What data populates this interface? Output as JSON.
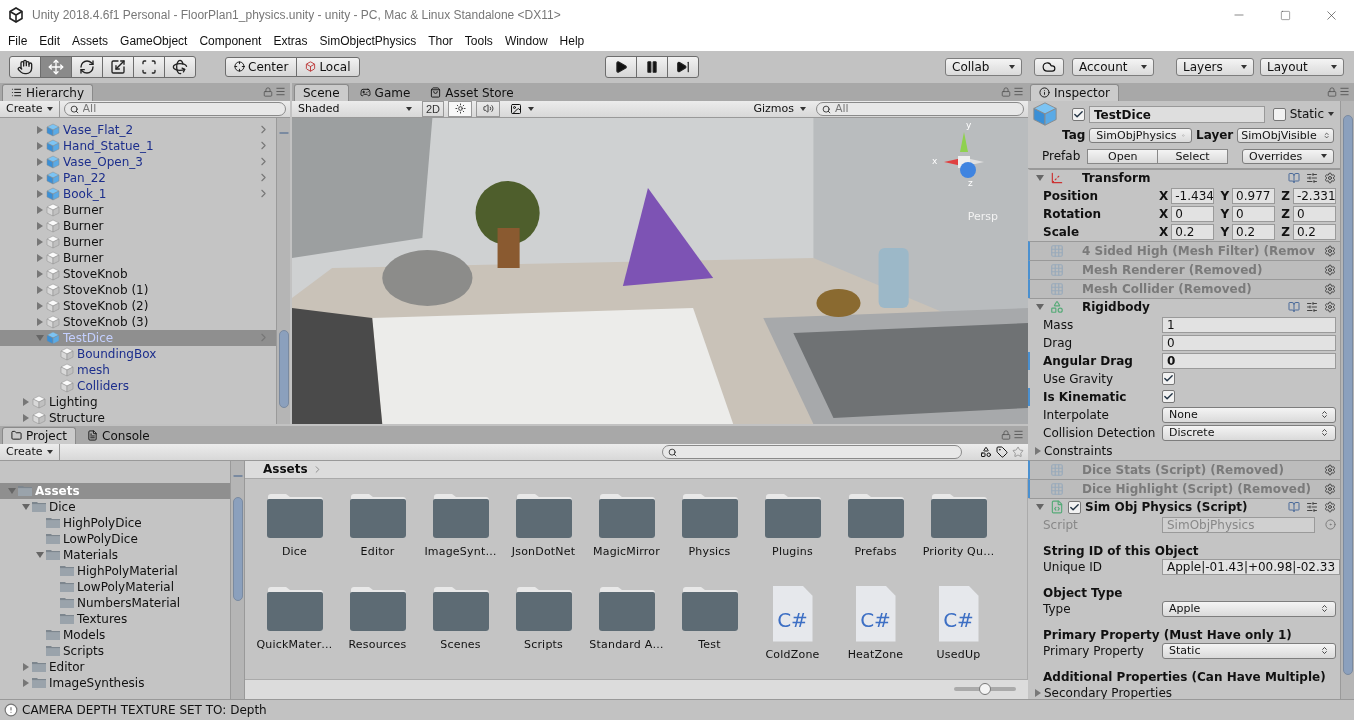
{
  "window": {
    "title": "Unity 2018.4.6f1 Personal - FloorPlan1_physics.unity - unity - PC, Mac & Linux Standalone <DX11>"
  },
  "menu": [
    "File",
    "Edit",
    "Assets",
    "GameObject",
    "Component",
    "Extras",
    "SimObjectPhysics",
    "Thor",
    "Tools",
    "Window",
    "Help"
  ],
  "toolbar": {
    "tools": [
      {
        "kind": "hand",
        "selected": false
      },
      {
        "kind": "move",
        "selected": true
      },
      {
        "kind": "rotate",
        "selected": false
      },
      {
        "kind": "scale",
        "selected": false
      },
      {
        "kind": "rect",
        "selected": false
      },
      {
        "kind": "transform",
        "selected": false
      }
    ],
    "pivot": [
      {
        "kind": "center",
        "label": "Center"
      },
      {
        "kind": "local",
        "label": "Local"
      }
    ],
    "play": [
      {
        "kind": "play"
      },
      {
        "kind": "pause"
      },
      {
        "kind": "step"
      }
    ],
    "collab": "Collab",
    "account": "Account",
    "layers": "Layers",
    "layout": "Layout"
  },
  "hierarchy": {
    "tab": {
      "label": "Hierarchy",
      "selected": true
    },
    "create": "Create",
    "search": {
      "placeholder": "All"
    },
    "scrolled_children": [
      {
        "name": "Vase_Flat_2",
        "kind": "prefab",
        "selected": false,
        "expanded": false
      },
      {
        "name": "Hand_Statue_1",
        "kind": "prefab",
        "selected": false,
        "expanded": false
      },
      {
        "name": "Vase_Open_3",
        "kind": "prefab",
        "selected": false,
        "expanded": false
      },
      {
        "name": "Pan_22",
        "kind": "prefab",
        "selected": false,
        "expanded": false
      },
      {
        "name": "Book_1",
        "kind": "prefab",
        "selected": false,
        "expanded": false
      },
      {
        "name": "Burner",
        "kind": "object",
        "selected": false,
        "expanded": false
      },
      {
        "name": "Burner",
        "kind": "object",
        "selected": false,
        "expanded": false
      },
      {
        "name": "Burner",
        "kind": "object",
        "selected": false,
        "expanded": false
      },
      {
        "name": "Burner",
        "kind": "object",
        "selected": false,
        "expanded": false
      },
      {
        "name": "StoveKnob",
        "kind": "object",
        "selected": false,
        "expanded": false
      },
      {
        "name": "StoveKnob (1)",
        "kind": "object",
        "selected": false,
        "expanded": false
      },
      {
        "name": "StoveKnob (2)",
        "kind": "object",
        "selected": false,
        "expanded": false
      },
      {
        "name": "StoveKnob (3)",
        "kind": "object",
        "selected": false,
        "expanded": false
      },
      {
        "name": "TestDice",
        "kind": "prefab",
        "selected": true,
        "expanded": true,
        "children": [
          {
            "name": "BoundingBox",
            "kind": "prefab_part",
            "selected": false
          },
          {
            "name": "mesh",
            "kind": "prefab_part",
            "selected": false
          },
          {
            "name": "Colliders",
            "kind": "prefab_part",
            "selected": false
          }
        ]
      }
    ],
    "items": [
      {
        "name": "Lighting",
        "kind": "object",
        "selected": false,
        "expanded": false
      },
      {
        "name": "Structure",
        "kind": "object",
        "selected": false,
        "expanded": false
      }
    ]
  },
  "scene": {
    "tabs": [
      {
        "label": "Scene",
        "kind": "scene",
        "selected": true
      },
      {
        "label": "Game",
        "kind": "game",
        "selected": false
      },
      {
        "label": "Asset Store",
        "kind": "store",
        "selected": false
      }
    ],
    "shading": "Shaded",
    "mode_2d": "2D",
    "toggles": [
      {
        "kind": "lighting",
        "on": true
      },
      {
        "kind": "audio",
        "on": false
      }
    ],
    "gizmos": "Gizmos",
    "search": {
      "placeholder": "All"
    },
    "gizmo_axes": [
      "y",
      "x",
      "z"
    ],
    "camera": "Persp"
  },
  "project": {
    "tabs": [
      {
        "label": "Project",
        "kind": "project",
        "selected": true
      },
      {
        "label": "Console",
        "kind": "console",
        "selected": false
      }
    ],
    "create": "Create",
    "tree": [
      {
        "name": "Assets",
        "selected": true,
        "expanded": true,
        "children": [
          {
            "name": "Dice",
            "selected": false,
            "expanded": true,
            "children": [
              {
                "name": "HighPolyDice",
                "selected": false
              },
              {
                "name": "LowPolyDice",
                "selected": false
              },
              {
                "name": "Materials",
                "selected": false,
                "expanded": true,
                "children": [
                  {
                    "name": "HighPolyMaterial",
                    "selected": false
                  },
                  {
                    "name": "LowPolyMaterial",
                    "selected": false
                  },
                  {
                    "name": "NumbersMaterial",
                    "selected": false
                  },
                  {
                    "name": "Textures",
                    "selected": false
                  }
                ]
              },
              {
                "name": "Models",
                "selected": false
              },
              {
                "name": "Scripts",
                "selected": false
              }
            ]
          },
          {
            "name": "Editor",
            "selected": false,
            "expanded": false
          },
          {
            "name": "ImageSynthesis",
            "selected": false,
            "expanded": false
          }
        ]
      }
    ],
    "breadcrumb": "Assets",
    "assets": [
      {
        "name": "Dice",
        "kind": "folder"
      },
      {
        "name": "Editor",
        "kind": "folder"
      },
      {
        "name": "ImageSynt…",
        "kind": "folder"
      },
      {
        "name": "JsonDotNet",
        "kind": "folder"
      },
      {
        "name": "MagicMirror",
        "kind": "folder"
      },
      {
        "name": "Physics",
        "kind": "folder"
      },
      {
        "name": "Plugins",
        "kind": "folder"
      },
      {
        "name": "Prefabs",
        "kind": "folder"
      },
      {
        "name": "Priority Qu…",
        "kind": "folder"
      },
      {
        "name": "QuickMater…",
        "kind": "folder"
      },
      {
        "name": "Resources",
        "kind": "folder"
      },
      {
        "name": "Scenes",
        "kind": "folder"
      },
      {
        "name": "Scripts",
        "kind": "folder"
      },
      {
        "name": "Standard A…",
        "kind": "folder"
      },
      {
        "name": "Test",
        "kind": "folder"
      },
      {
        "name": "ColdZone",
        "kind": "script",
        "badge": "C#"
      },
      {
        "name": "HeatZone",
        "kind": "script",
        "badge": "C#"
      },
      {
        "name": "UsedUp",
        "kind": "script",
        "badge": "C#"
      }
    ],
    "zoom_slider": {
      "level": 0.5
    }
  },
  "inspector": {
    "tab": {
      "label": "Inspector",
      "selected": true
    },
    "object": {
      "active": true,
      "name": "TestDice",
      "static_label": "Static",
      "static": false,
      "tag_label": "Tag",
      "tag": "SimObjPhysics",
      "layer_label": "Layer",
      "layer": "SimObjVisible",
      "prefab_label": "Prefab",
      "prefab_buttons": [
        "Open",
        "Select"
      ],
      "overrides": "Overrides"
    },
    "components": [
      {
        "kind": "transform",
        "title": "Transform",
        "expanded": true,
        "rows": [
          {
            "label": "Position",
            "values": [
              {
                "axis": "X",
                "value": "-1.434"
              },
              {
                "axis": "Y",
                "value": "0.977"
              },
              {
                "axis": "Z",
                "value": "-2.331"
              }
            ]
          },
          {
            "label": "Rotation",
            "values": [
              {
                "axis": "X",
                "value": "0"
              },
              {
                "axis": "Y",
                "value": "0"
              },
              {
                "axis": "Z",
                "value": "0"
              }
            ]
          },
          {
            "label": "Scale",
            "values": [
              {
                "axis": "X",
                "value": "0.2"
              },
              {
                "axis": "Y",
                "value": "0.2"
              },
              {
                "axis": "Z",
                "value": "0.2"
              }
            ]
          }
        ]
      },
      {
        "kind": "removed",
        "title": "4 Sided High (Mesh Filter) (Remov"
      },
      {
        "kind": "removed",
        "title": "Mesh Renderer (Removed)"
      },
      {
        "kind": "removed",
        "title": "Mesh Collider (Removed)"
      },
      {
        "kind": "fields",
        "title": "Rigidbody",
        "expanded": true,
        "fields": [
          {
            "kind": "text",
            "label": "Mass",
            "value": "1",
            "overridden": false
          },
          {
            "kind": "text",
            "label": "Drag",
            "value": "0",
            "overridden": false
          },
          {
            "kind": "text",
            "label": "Angular Drag",
            "value": "0",
            "overridden": true
          },
          {
            "kind": "checkbox",
            "label": "Use Gravity",
            "checked": true,
            "overridden": false
          },
          {
            "kind": "checkbox",
            "label": "Is Kinematic",
            "checked": true,
            "overridden": true
          },
          {
            "kind": "dropdown",
            "label": "Interpolate",
            "value": "None",
            "overridden": false
          },
          {
            "kind": "dropdown",
            "label": "Collision Detection",
            "value": "Discrete",
            "overridden": false
          },
          {
            "kind": "foldout",
            "label": "Constraints",
            "expanded": false
          }
        ]
      },
      {
        "kind": "removed",
        "title": "Dice Stats (Script) (Removed)"
      },
      {
        "kind": "removed",
        "title": "Dice Highlight (Script) (Removed)"
      },
      {
        "kind": "fields",
        "title": "Sim Obj Physics (Script)",
        "enabled": true,
        "expanded": true,
        "fields": [
          {
            "kind": "object",
            "label": "Script",
            "value": "SimObjPhysics",
            "disabled": true
          },
          {
            "kind": "header",
            "label": "String ID of this Object"
          },
          {
            "kind": "text",
            "label": "Unique ID",
            "value": "Apple|-01.43|+00.98|-02.33",
            "overridden": false
          },
          {
            "kind": "header",
            "label": "Object Type"
          },
          {
            "kind": "dropdown",
            "label": "Type",
            "value": "Apple",
            "overridden": false
          },
          {
            "kind": "header",
            "label": "Primary Property (Must Have only 1)"
          },
          {
            "kind": "dropdown",
            "label": "Primary Property",
            "value": "Static",
            "overridden": false
          },
          {
            "kind": "header",
            "label": "Additional Properties (Can Have Multiple)"
          },
          {
            "kind": "foldout",
            "label": "Secondary Properties",
            "expanded": false
          }
        ]
      }
    ]
  },
  "status_bar": {
    "kind": "warning",
    "message": "CAMERA DEPTH TEXTURE SET TO: Depth"
  }
}
